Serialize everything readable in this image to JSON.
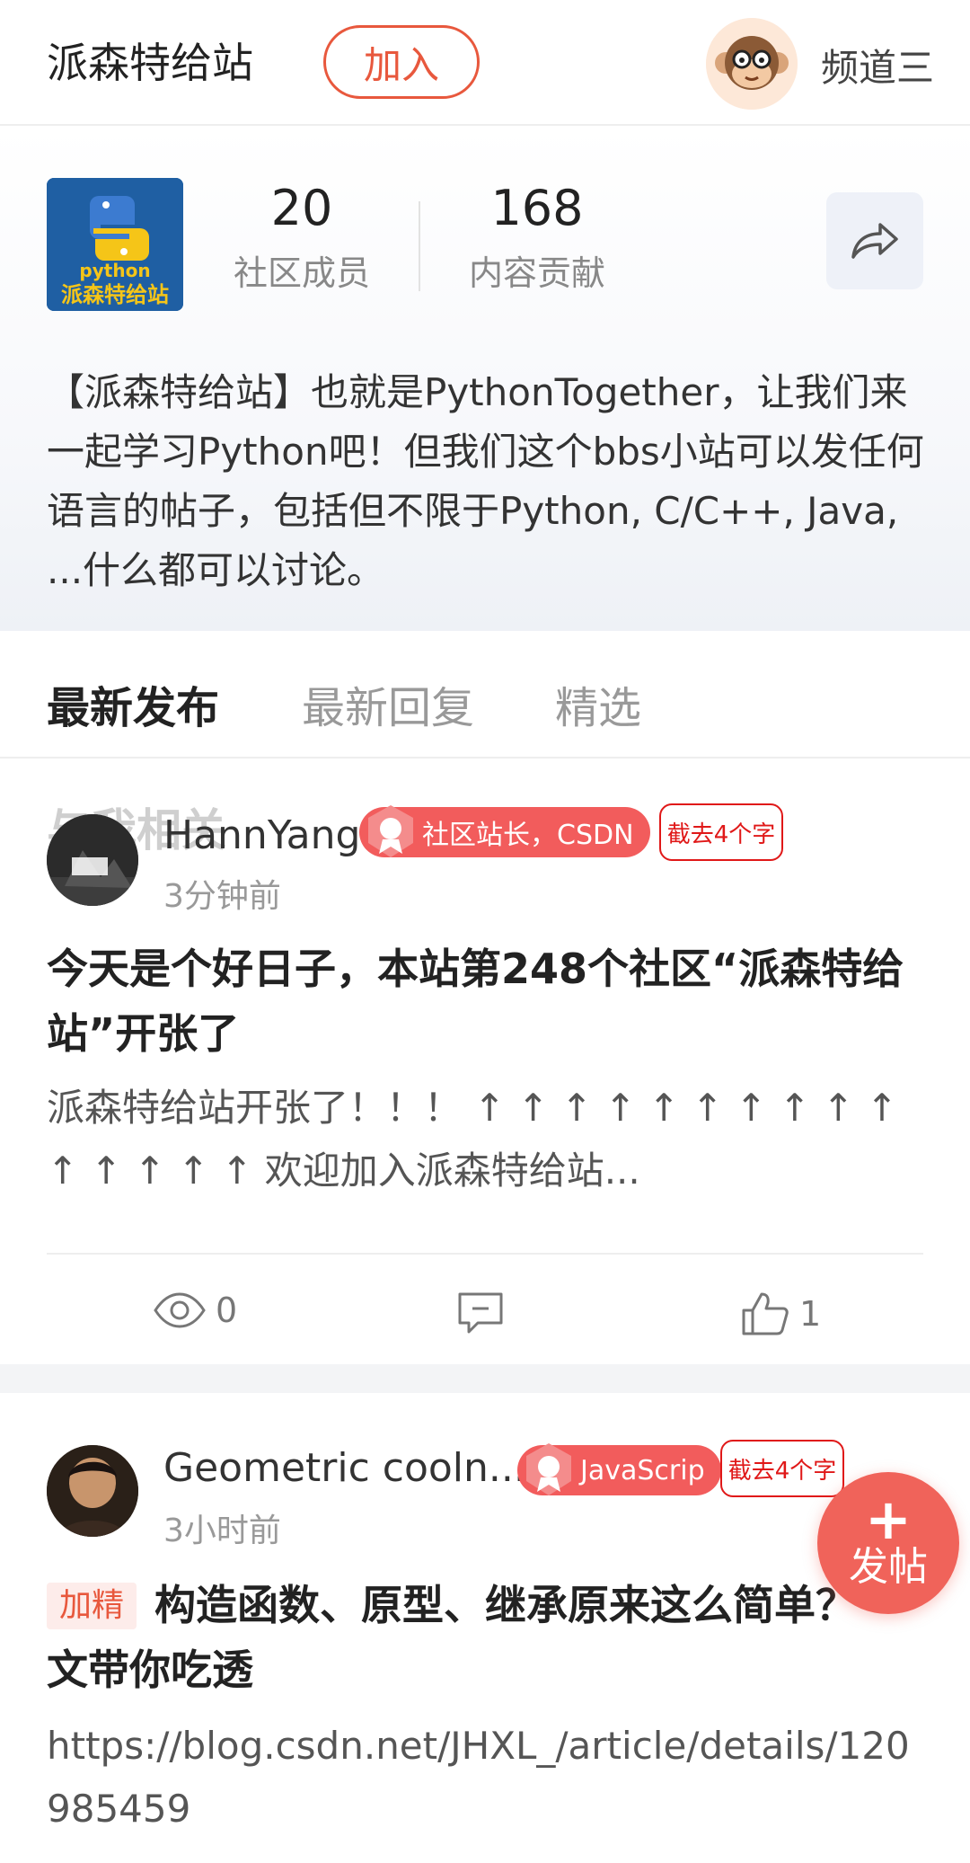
{
  "header": {
    "title": "派森特给站",
    "join_label": "加入",
    "channel_label": "频道三"
  },
  "community": {
    "logo_text_top": "python",
    "logo_text_bottom": "派森特给站",
    "members_count": "20",
    "members_label": "社区成员",
    "contrib_count": "168",
    "contrib_label": "内容贡献",
    "description": "【派森特给站】也就是PythonTogether，让我们来一起学习Python吧！但我们这个bbs小站可以发任何语言的帖子，包括但不限于Python, C/C++, Java, ...什么都可以讨论。"
  },
  "tabs": [
    {
      "label": "最新发布",
      "active": true
    },
    {
      "label": "最新回复",
      "active": false
    },
    {
      "label": "精选",
      "active": false
    }
  ],
  "posts": [
    {
      "overlay_label": "与我相关",
      "author": "HannYang",
      "badge": "社区站长，CSDN",
      "cut_note": "截去4个字",
      "time": "3分钟前",
      "title": "今天是个好日子，本站第248个社区“派森特给站”开张了",
      "body": "派森特给站开张了！！！ ↑ ↑ ↑ ↑ ↑ ↑ ↑ ↑ ↑ ↑ ↑ ↑ ↑ ↑ ↑ 欢迎加入派森特给站...",
      "views": "0",
      "likes": "1"
    },
    {
      "author": "Geometric cooln...",
      "badge": "JavaScrip",
      "cut_note": "截去4个字",
      "time": "3小时前",
      "tag": "加精",
      "title": "构造函数、原型、继承原来这么简单？一文带你吃透",
      "body": "https://blog.csdn.net/JHXL_/article/details/120985459"
    }
  ],
  "fab": {
    "plus": "+",
    "label": "发帖"
  },
  "colors": {
    "accent": "#e8583d",
    "badge": "#f25c5c",
    "fab": "#f0635a"
  }
}
